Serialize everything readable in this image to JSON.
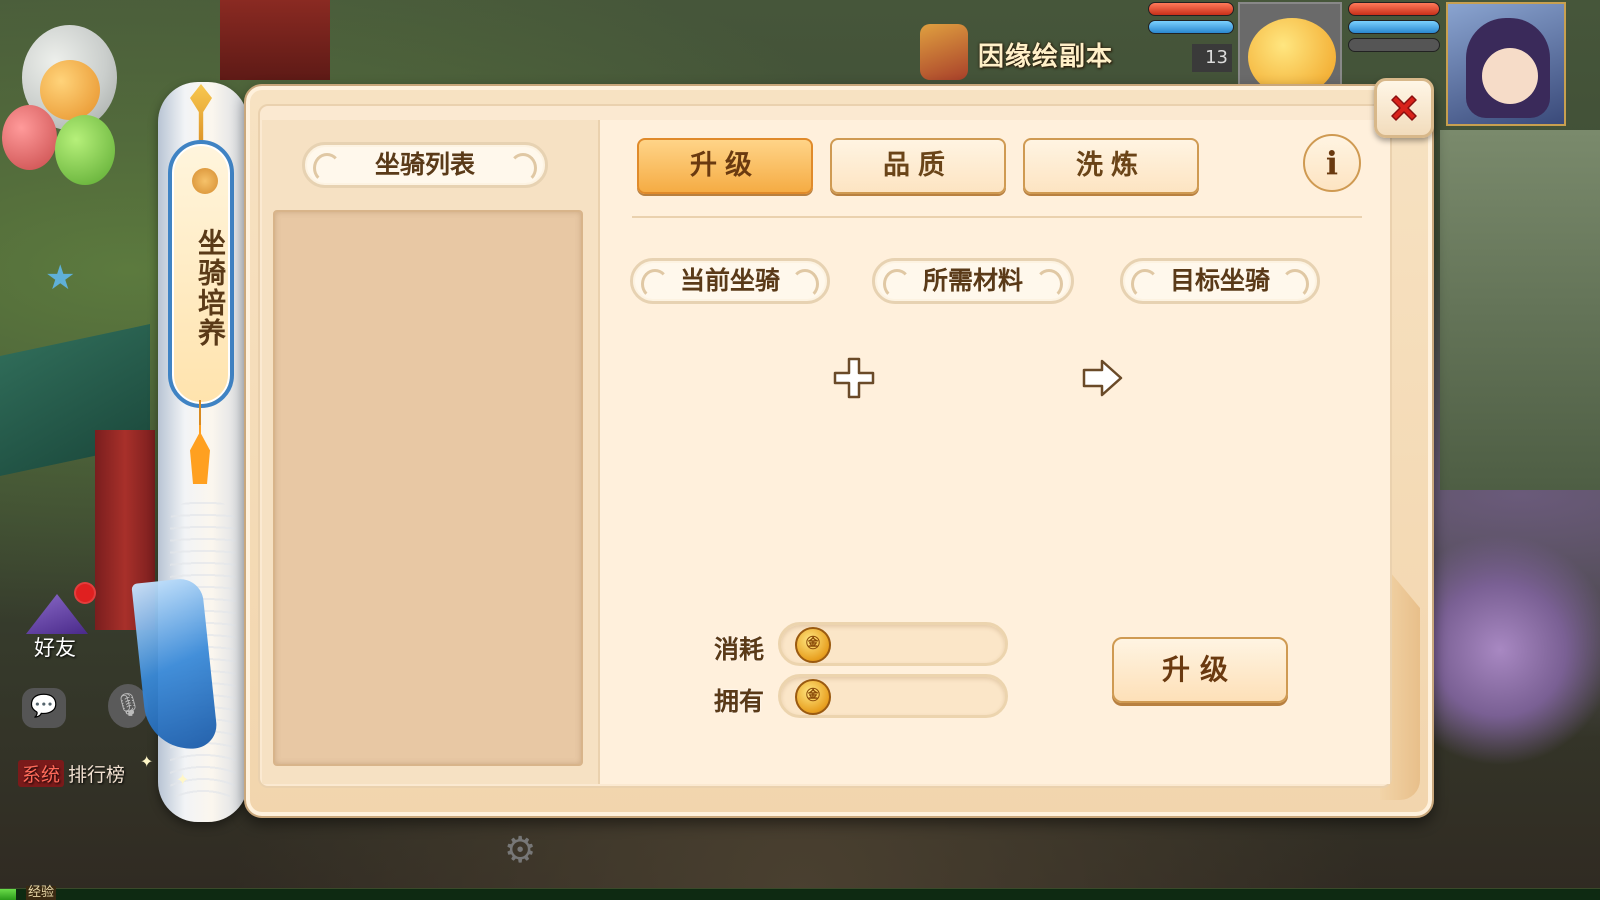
{
  "hud": {
    "event_title": "因缘绘副本",
    "player_level": "13",
    "friends_label": "好友",
    "chat_tag": "系统",
    "chat_text": "排行榜",
    "exp_label": "经验",
    "exp_progress": 0.01
  },
  "side_tab": {
    "label": "坐骑培养"
  },
  "mount_list": {
    "title": "坐骑列表",
    "items": []
  },
  "tabs": [
    {
      "label": "升级",
      "active": true
    },
    {
      "label": "品质",
      "active": false
    },
    {
      "label": "洗炼",
      "active": false
    }
  ],
  "info_button": {
    "label": "i"
  },
  "sections": {
    "current_mount": "当前坐骑",
    "materials": "所需材料",
    "target_mount": "目标坐骑"
  },
  "cost": {
    "consume_label": "消耗",
    "consume_value": "",
    "own_label": "拥有",
    "own_value": "",
    "currency_icon": "gold-coin-icon"
  },
  "actions": {
    "upgrade_label": "升级"
  },
  "icons": {
    "plus": "plus-icon",
    "arrow": "arrow-right-icon",
    "close": "close-icon",
    "info": "info-icon"
  },
  "colors": {
    "active_tab": "#f5ac44",
    "close_x": "#d8221a",
    "panel_bg": "#fbe9d1",
    "side_tab_border": "#3f83c4"
  }
}
